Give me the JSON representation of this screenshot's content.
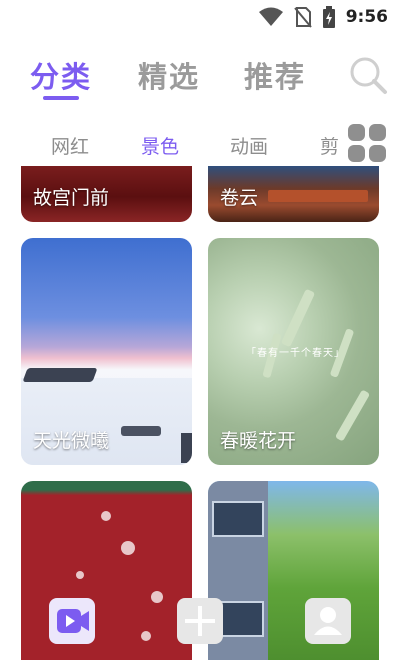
{
  "status_bar": {
    "time": "9:56",
    "icons": [
      "wifi-icon",
      "no-sim-icon",
      "battery-icon"
    ]
  },
  "main_tabs": [
    {
      "label": "分类",
      "active": true
    },
    {
      "label": "精选",
      "active": false
    },
    {
      "label": "推荐",
      "active": false
    }
  ],
  "category_tabs": [
    {
      "label": "网红",
      "active": false
    },
    {
      "label": "景色",
      "active": true
    },
    {
      "label": "动画",
      "active": false
    },
    {
      "label": "剪",
      "active": false
    }
  ],
  "cards": [
    {
      "label": "故宫门前"
    },
    {
      "label": "卷云"
    },
    {
      "label": "天光微曦"
    },
    {
      "label": "春暖花开",
      "caption": "「春有一千个春天」"
    },
    {
      "label": ""
    },
    {
      "label": ""
    }
  ],
  "bottom_buttons": [
    "video-icon",
    "add-icon",
    "user-icon"
  ],
  "colors": {
    "accent": "#7c5cf0",
    "inactive_text": "#9b9b9b"
  }
}
